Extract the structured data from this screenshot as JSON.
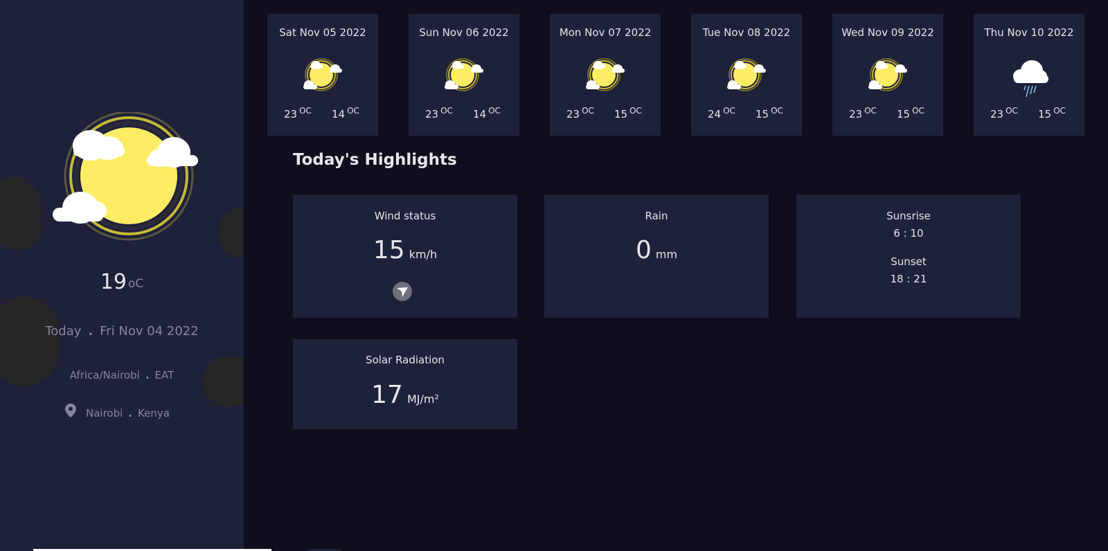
{
  "sidebar": {
    "current_temp": "19",
    "temp_unit": "oC",
    "date_prefix": "Today",
    "date": "Fri Nov 04 2022",
    "timezone": "Africa/Nairobi",
    "timezone_abbr": "EAT",
    "city": "Nairobi",
    "country": "Kenya",
    "icon": "sun-with-clouds-icon"
  },
  "forecast": [
    {
      "date": "Sat Nov 05 2022",
      "max": "23",
      "min": "14",
      "unit": "OC",
      "icon": "sun-cloud-icon"
    },
    {
      "date": "Sun Nov 06 2022",
      "max": "23",
      "min": "14",
      "unit": "OC",
      "icon": "sun-cloud-icon"
    },
    {
      "date": "Mon Nov 07 2022",
      "max": "23",
      "min": "15",
      "unit": "OC",
      "icon": "sun-cloud-icon"
    },
    {
      "date": "Tue Nov 08 2022",
      "max": "24",
      "min": "15",
      "unit": "OC",
      "icon": "sun-cloud-icon"
    },
    {
      "date": "Wed Nov 09 2022",
      "max": "23",
      "min": "15",
      "unit": "OC",
      "icon": "sun-cloud-icon"
    },
    {
      "date": "Thu Nov 10 2022",
      "max": "23",
      "min": "15",
      "unit": "OC",
      "icon": "rain-cloud-icon"
    }
  ],
  "highlights": {
    "title": "Today's Highlights",
    "wind": {
      "label": "Wind status",
      "value": "15",
      "unit": "km/h"
    },
    "rain": {
      "label": "Rain",
      "value": "0",
      "unit": "mm"
    },
    "sun": {
      "sunrise_label": "Sunsrise",
      "sunrise": "6 : 10",
      "sunset_label": "Sunset",
      "sunset": "18 : 21"
    },
    "solar": {
      "label": "Solar Radiation",
      "value": "17",
      "unit": "MJ/m²"
    }
  },
  "colors": {
    "background": "#100e1d",
    "panel": "#1e213a",
    "text": "#e7e7eb",
    "muted": "#88869d",
    "sun": "#ffec65"
  }
}
